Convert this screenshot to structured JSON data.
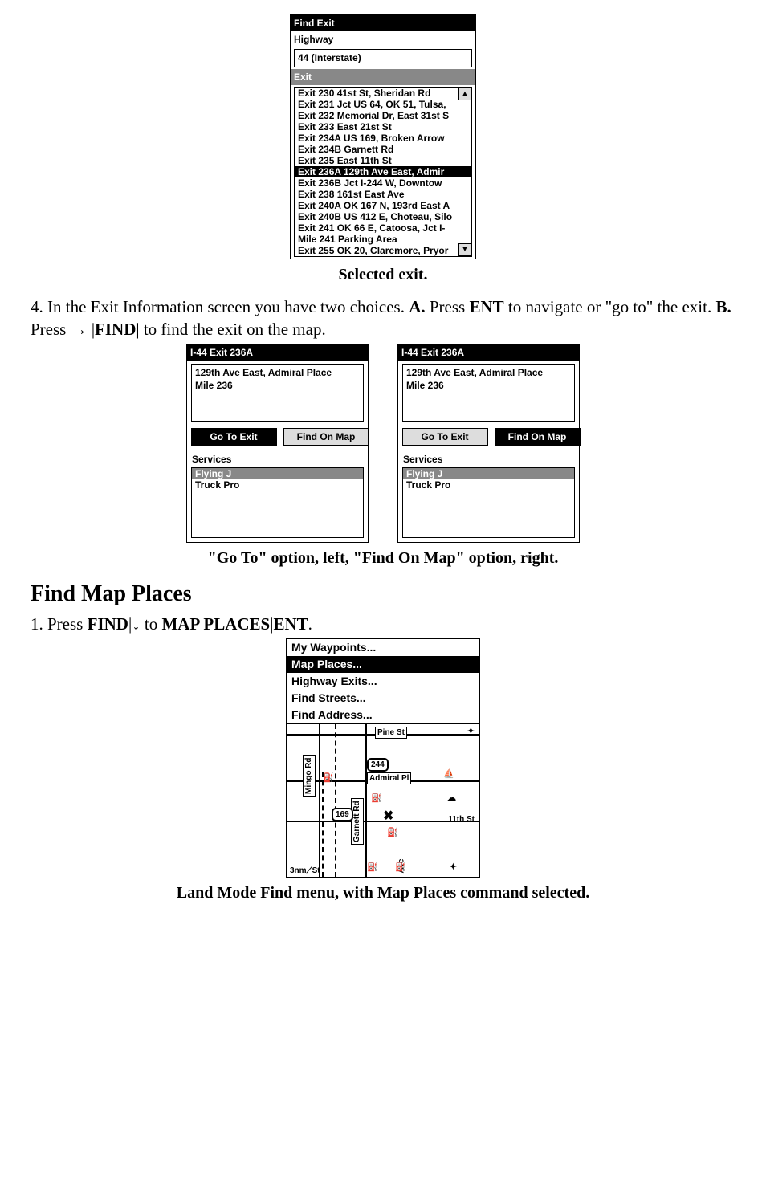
{
  "fig1": {
    "titlebar": "Find Exit",
    "hwy_label": "Highway",
    "hwy_value": "44 (Interstate)",
    "exit_label": "Exit",
    "items": [
      "Exit 230 41st St, Sheridan Rd",
      "Exit 231 Jct US 64, OK 51, Tulsa,",
      "Exit 232 Memorial Dr, East 31st S",
      "Exit 233 East 21st St",
      "Exit 234A US 169, Broken Arrow",
      "Exit 234B Garnett Rd",
      "Exit 235 East 11th St",
      "Exit 236A 129th Ave East, Admir",
      "Exit 236B Jct I-244 W, Downtow",
      "Exit 238 161st East Ave",
      "Exit 240A OK 167 N, 193rd East A",
      "Exit 240B US 412 E, Choteau, Silo",
      "Exit 241 OK 66 E, Catoosa, Jct I-",
      "Mile 241 Parking Area",
      "Exit 255 OK 20, Claremore, Pryor"
    ],
    "selected_index": 7,
    "caption": "Selected exit."
  },
  "para4": {
    "lead": "4. In the Exit Information screen you have two choices. ",
    "boldA": "A.",
    "afterA": " Press ",
    "keyEnt": "ENT",
    "afterEnt": " to navigate or \"go to\" the exit. ",
    "boldB": "B.",
    "afterB": " Press → |",
    "keyFind": "FIND",
    "afterFind": "| to find the exit on the map."
  },
  "exitcards": {
    "titlebar": "I-44 Exit 236A",
    "desc_line1": "129th Ave East, Admiral Place",
    "desc_line2": "Mile 236",
    "goto": "Go To Exit",
    "findmap": "Find On Map",
    "services": "Services",
    "svc1": "Flying J",
    "svc2": "Truck Pro",
    "caption": "\"Go To\" option, left, \"Find On Map\" option, right."
  },
  "heading_findmap": "Find Map Places",
  "para_findmap": {
    "lead": "1. Press ",
    "keyFind": "FIND",
    "mid": "|↓ to ",
    "keyMap": "MAP PLACES",
    "mid2": "|",
    "keyEnt": "ENT",
    "end": "."
  },
  "mapmenu": {
    "items": [
      "My Waypoints...",
      "Map Places...",
      "Highway Exits...",
      "Find Streets...",
      "Find Address..."
    ],
    "selected_index": 1,
    "labels": {
      "pine": "Pine St",
      "admiral": "Admiral Pl",
      "eleventh": "11th St",
      "mingo": "Mingo Rd",
      "garnett": "Garnett Rd",
      "ave": "Ave",
      "shield244": "244",
      "shield169": "169",
      "scale": "3nm",
      "compass": "St"
    },
    "caption": "Land Mode Find menu, with Map Places command selected."
  }
}
